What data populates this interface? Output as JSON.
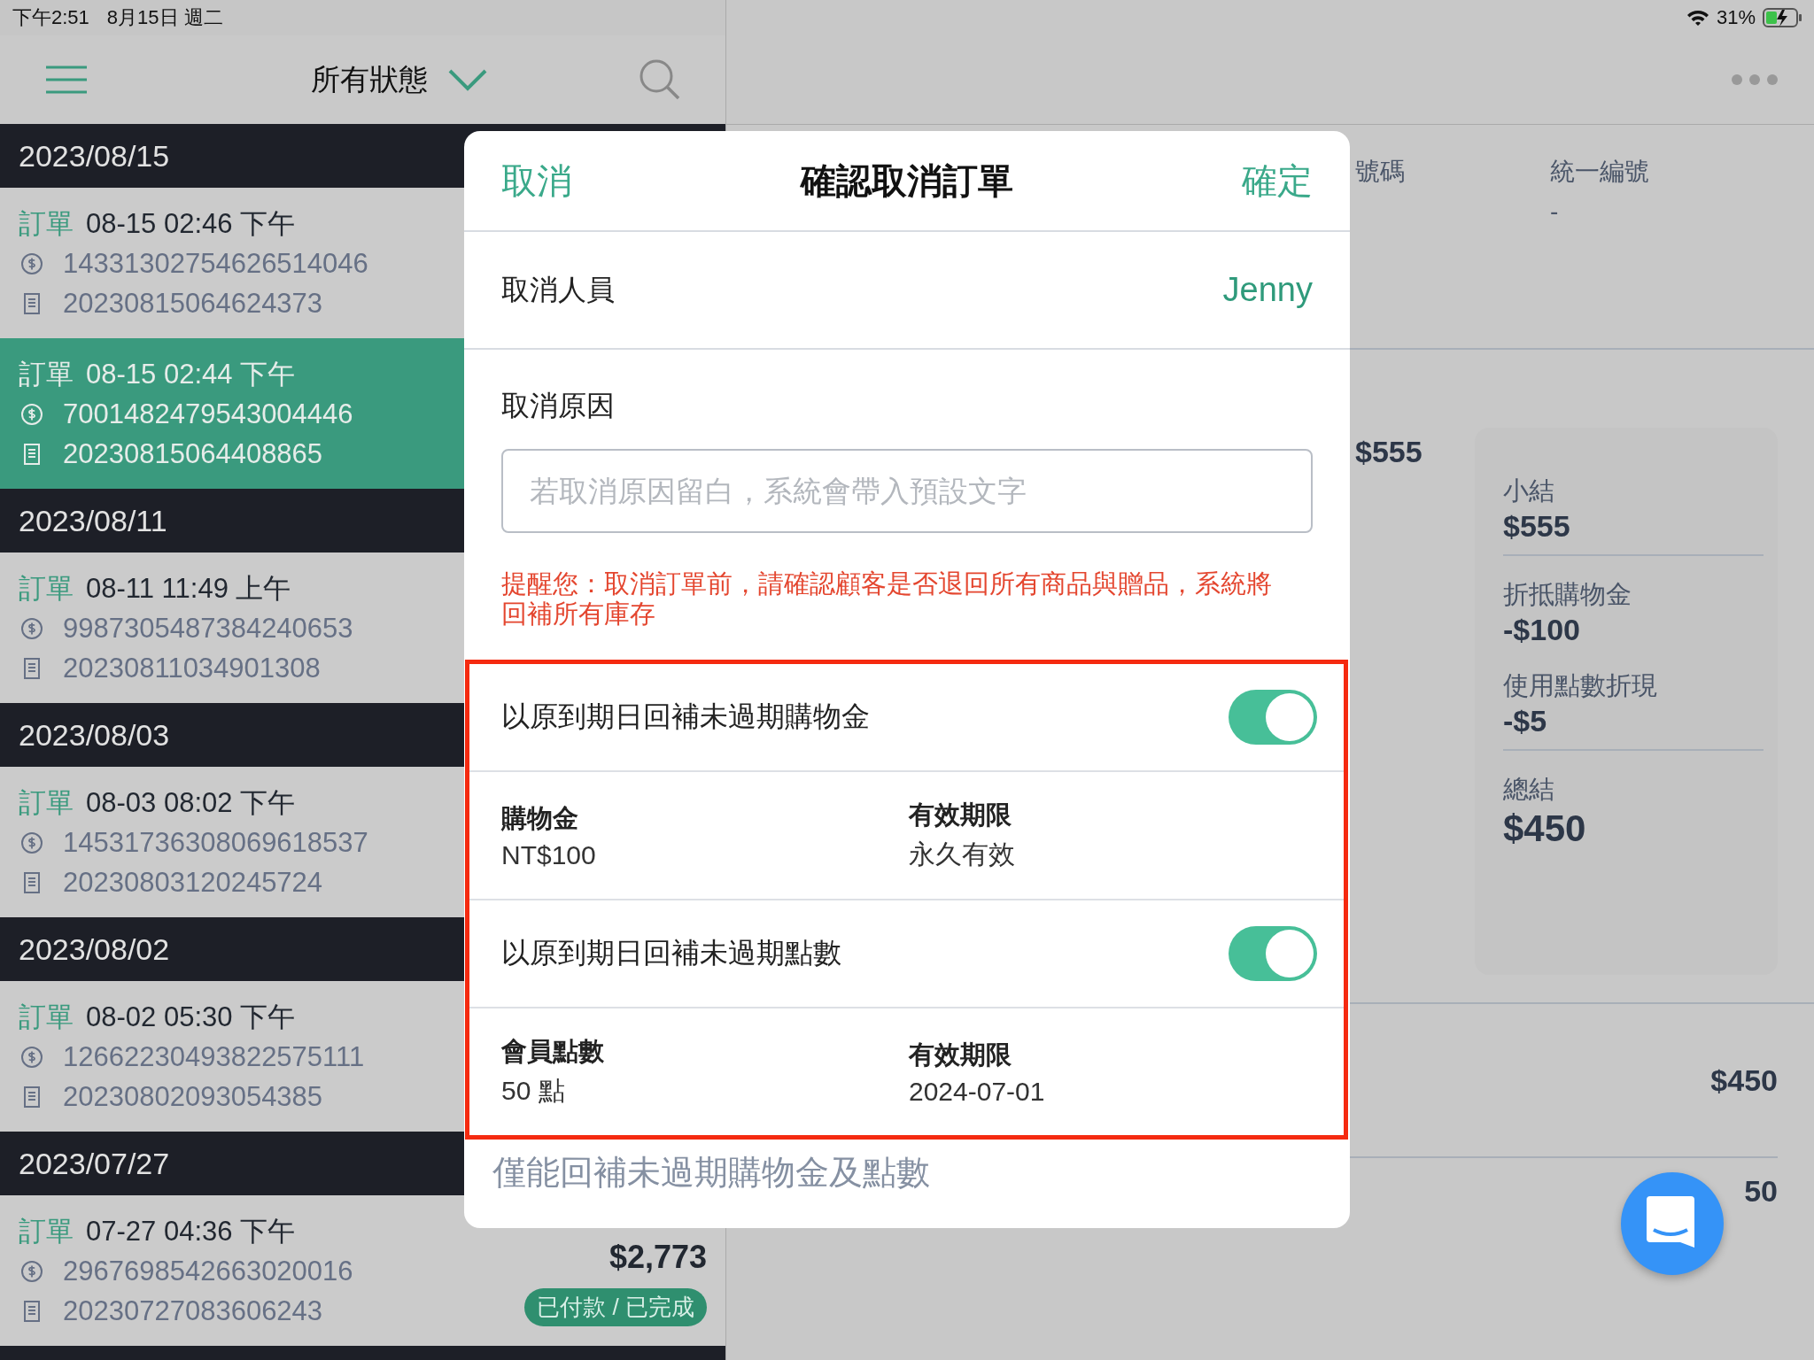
{
  "status_bar": {
    "time": "下午2:51",
    "date": "8月15日 週二",
    "battery": "31%"
  },
  "nav": {
    "filter": "所有狀態"
  },
  "order_groups": [
    {
      "date": "2023/08/15",
      "orders": [
        {
          "label": "訂單",
          "time": "08-15 02:46 下午",
          "payment_no": "14331302754626514046",
          "invoice_no": "20230815064624373",
          "selected": false
        },
        {
          "label": "訂單",
          "time": "08-15 02:44 下午",
          "payment_no": "7001482479543004446",
          "invoice_no": "20230815064408865",
          "selected": true
        }
      ]
    },
    {
      "date": "2023/08/11",
      "orders": [
        {
          "label": "訂單",
          "time": "08-11 11:49 上午",
          "payment_no": "9987305487384240653",
          "invoice_no": "20230811034901308",
          "selected": false
        }
      ]
    },
    {
      "date": "2023/08/03",
      "orders": [
        {
          "label": "訂單",
          "time": "08-03 08:02 下午",
          "payment_no": "14531736308069618537",
          "invoice_no": "20230803120245724",
          "selected": false
        }
      ]
    },
    {
      "date": "2023/08/02",
      "orders": [
        {
          "label": "訂單",
          "time": "08-02 05:30 下午",
          "payment_no": "12662230493822575111",
          "invoice_no": "20230802093054385",
          "selected": false
        }
      ]
    },
    {
      "date": "2023/07/27",
      "orders": [
        {
          "label": "訂單",
          "time": "07-27 04:36 下午",
          "payment_no": "2967698542663020016",
          "invoice_no": "20230727083606243",
          "selected": false,
          "amount": "$2,773",
          "status": "已付款 / 已完成"
        }
      ]
    }
  ],
  "detail": {
    "column_1_label": "號碼",
    "column_2_label": "統一編號",
    "column_2_value": "-",
    "item_price": "$555",
    "summary": [
      {
        "label": "小結",
        "value": "$555",
        "kind": "line",
        "divider": true
      },
      {
        "label": "折抵購物金",
        "value": "-$100",
        "kind": "line",
        "divider": false
      },
      {
        "label": "使用點數折現",
        "value": "-$5",
        "kind": "line",
        "divider": true
      },
      {
        "label": "總結",
        "value": "$450",
        "kind": "total",
        "divider": false
      }
    ],
    "total": "$450",
    "column_3": "50"
  },
  "dialog": {
    "cancel": "取消",
    "title": "確認取消訂單",
    "confirm": "確定",
    "staff_label": "取消人員",
    "staff_value": "Jenny",
    "reason_label": "取消原因",
    "reason_placeholder": "若取消原因留白，系統會帶入預設文字",
    "warning": "提醒您：取消訂單前，請確認顧客是否退回所有商品與贈品，系統將回補所有庫存",
    "restock": [
      {
        "label": "以原到期日回補未過期購物金",
        "on": true,
        "fields": [
          {
            "label": "購物金",
            "value": "NT$100"
          },
          {
            "label": "有效期限",
            "value": "永久有效"
          }
        ]
      },
      {
        "label": "以原到期日回補未過期點數",
        "on": true,
        "fields": [
          {
            "label": "會員點數",
            "value": "50 點"
          },
          {
            "label": "有效期限",
            "value": "2024-07-01"
          }
        ]
      }
    ],
    "note": "僅能回補未過期購物金及點數"
  }
}
